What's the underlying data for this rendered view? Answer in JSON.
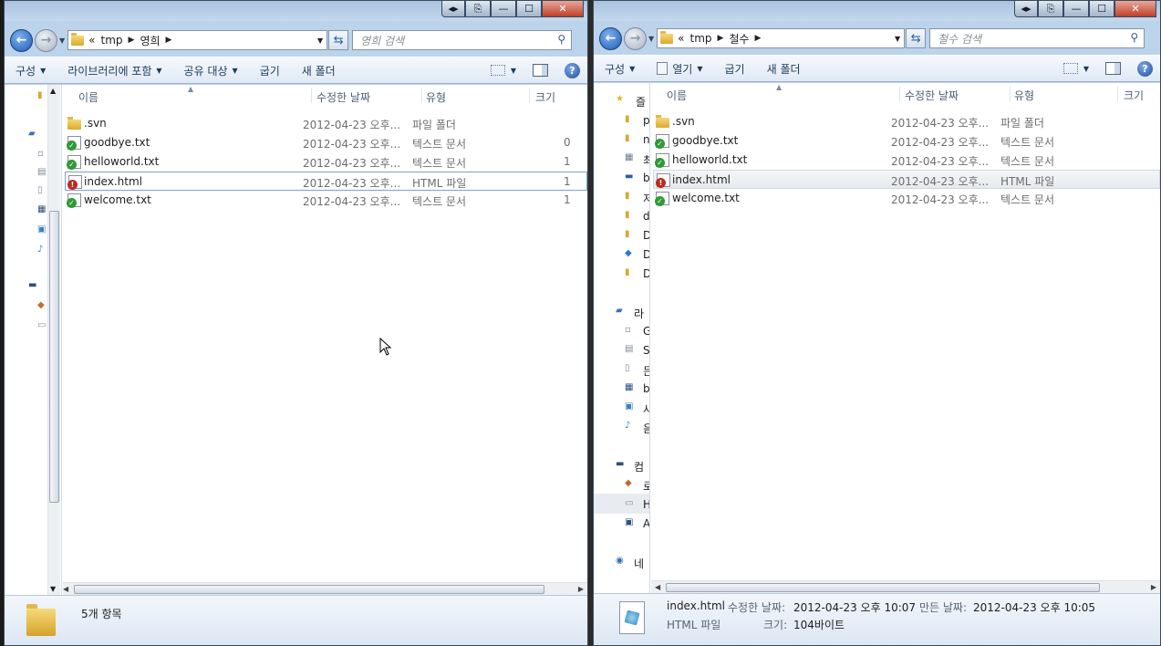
{
  "left": {
    "path": [
      "tmp",
      "영희"
    ],
    "path_prefix": "«",
    "search_placeholder": "영희 검색",
    "toolbar": [
      "구성",
      "라이브러리에 포함",
      "공유 대상",
      "굽기",
      "새 폴더"
    ],
    "columns": {
      "name": "이름",
      "date": "수정한 날짜",
      "type": "유형",
      "size": "크기"
    },
    "files": [
      {
        "name": ".svn",
        "date": "2012-04-23 오후...",
        "type": "파일 폴더",
        "size": "",
        "icon": "folder-icon"
      },
      {
        "name": "goodbye.txt",
        "date": "2012-04-23 오후...",
        "type": "텍스트 문서",
        "size": "0",
        "icon": "svn-normal-text-icon"
      },
      {
        "name": "helloworld.txt",
        "date": "2012-04-23 오후...",
        "type": "텍스트 문서",
        "size": "1",
        "icon": "svn-normal-text-icon"
      },
      {
        "name": "index.html",
        "date": "2012-04-23 오후...",
        "type": "HTML 파일",
        "size": "1",
        "icon": "svn-conflict-html-icon"
      },
      {
        "name": "welcome.txt",
        "date": "2012-04-23 오후...",
        "type": "텍스트 문서",
        "size": "1",
        "icon": "svn-normal-text-icon"
      }
    ],
    "status": "5개 항목"
  },
  "right": {
    "path": [
      "tmp",
      "철수"
    ],
    "path_prefix": "«",
    "search_placeholder": "철수 검색",
    "toolbar": [
      "구성",
      "열기",
      "굽기",
      "새 폴더"
    ],
    "columns": {
      "name": "이름",
      "date": "수정한 날짜",
      "type": "유형",
      "size": "크기"
    },
    "files": [
      {
        "name": ".svn",
        "date": "2012-04-23 오후...",
        "type": "파일 폴더",
        "icon": "folder-icon"
      },
      {
        "name": "goodbye.txt",
        "date": "2012-04-23 오후...",
        "type": "텍스트 문서",
        "icon": "svn-normal-text-icon"
      },
      {
        "name": "helloworld.txt",
        "date": "2012-04-23 오후...",
        "type": "텍스트 문서",
        "icon": "svn-normal-text-icon"
      },
      {
        "name": "index.html",
        "date": "2012-04-23 오후...",
        "type": "HTML 파일",
        "icon": "svn-conflict-html-icon"
      },
      {
        "name": "welcome.txt",
        "date": "2012-04-23 오후...",
        "type": "텍스트 문서",
        "icon": "svn-normal-text-icon"
      }
    ],
    "nav": [
      "즐",
      "p",
      "n",
      "최",
      "b",
      "저",
      "d",
      "D",
      "D",
      "D",
      "라",
      "G",
      "S",
      "든",
      "b",
      "사",
      "음",
      "컴",
      "로",
      "H",
      "A",
      "네"
    ],
    "details": {
      "name": "index.html",
      "modified_label": "수정한 날짜:",
      "modified": "2012-04-23 오후 10:07",
      "created_label": "만든 날짜:",
      "created": "2012-04-23 오후 10:05",
      "type": "HTML 파일",
      "size_label": "크기:",
      "size": "104바이트"
    }
  },
  "caption": {
    "restore": "◂▸",
    "dock": "⎘",
    "minimize": "—",
    "maximize": "☐",
    "close": "✕"
  },
  "colors": {
    "accent": "#1c5bb4",
    "selection_border": "#7da2ce",
    "conflict": "#c0281e",
    "normal": "#2f9a36"
  }
}
